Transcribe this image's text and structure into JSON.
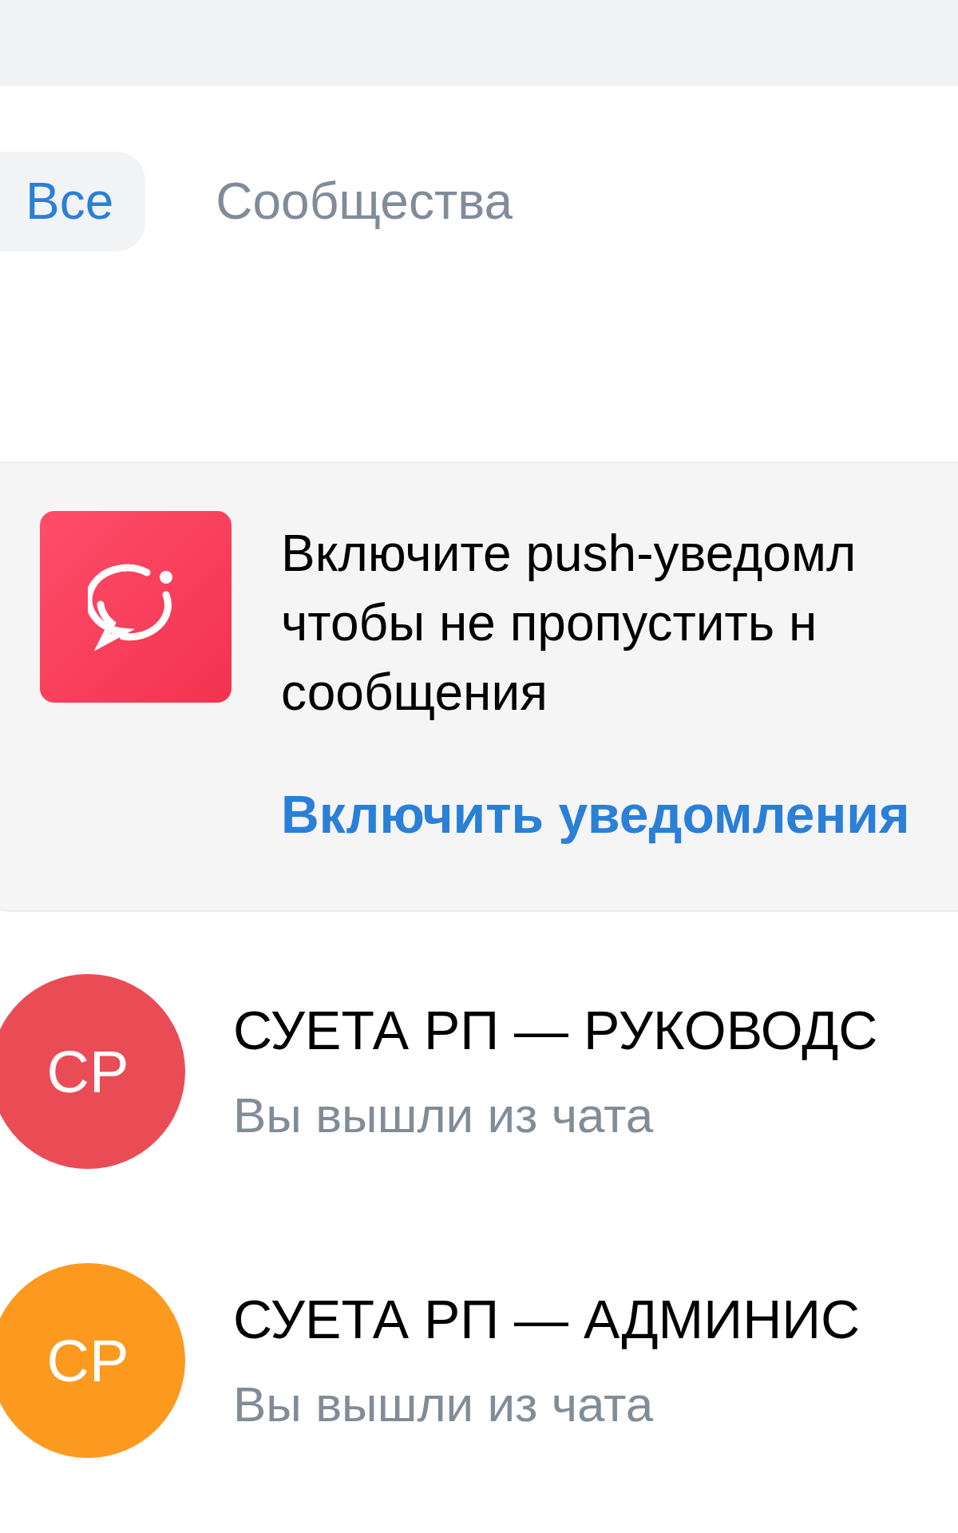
{
  "tabs": [
    {
      "label": "Все",
      "selected": true
    },
    {
      "label": "Сообщества",
      "selected": false
    }
  ],
  "banner": {
    "text": "Включите push-уведомл\nчтобы не пропустить н\nсообщения",
    "action": "Включить уведомления"
  },
  "chats": [
    {
      "initials": "СР",
      "color": "#ea4c55",
      "title": "СУЕТА РП — РУКОВОДС",
      "subtitle": "Вы вышли из чата"
    },
    {
      "initials": "СР",
      "color": "#fb9a1e",
      "title": "СУЕТА РП — АДМИНИС",
      "subtitle": "Вы вышли из чата"
    }
  ]
}
